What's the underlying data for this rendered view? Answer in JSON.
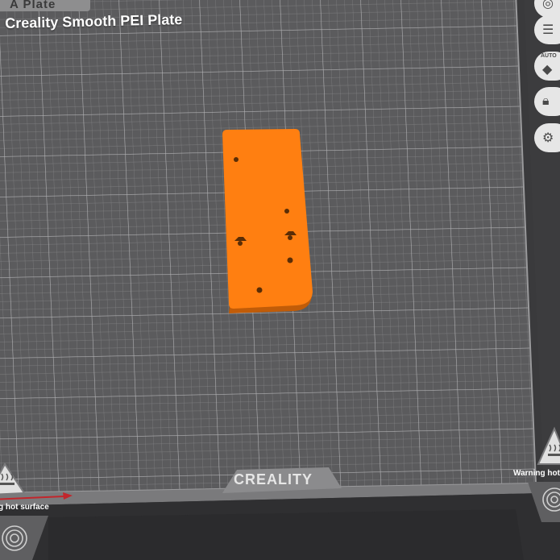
{
  "plate": {
    "tab_label": "A Plate",
    "name": "Creality Smooth PEI Plate"
  },
  "bed": {
    "brand": "CREALITY",
    "warning_left": "g hot surface",
    "warning_right": "Warning hot",
    "colors": {
      "bed_surface": "#5b5b5d",
      "grid_line": "#a6a6a8",
      "bed_frame": "#4a4a4c",
      "model": "#ff7f11",
      "x_axis": "#c2262c"
    }
  },
  "sidebar": {
    "buttons": [
      {
        "icon": "list-icon"
      },
      {
        "icon": "auto-orient-icon",
        "label": "AUTO"
      },
      {
        "icon": "lock-icon"
      },
      {
        "icon": "gear-icon"
      }
    ]
  },
  "model": {
    "name": "orange-part"
  }
}
